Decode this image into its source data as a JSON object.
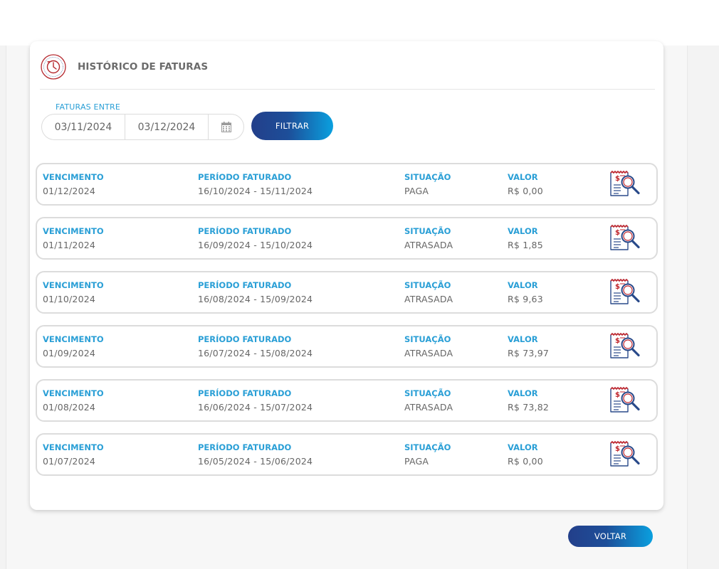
{
  "page": {
    "title": "HISTÓRICO DE FATURAS",
    "icon": "clock-seal-icon",
    "accent_color": "#2a9fd6",
    "brand_color": "#233f8a"
  },
  "filter": {
    "label": "FATURAS ENTRE",
    "start_date": "03/11/2024",
    "end_date": "03/12/2024",
    "button_label": "FILTRAR",
    "calendar_icon": "calendar-icon"
  },
  "columns": {
    "due": "VENCIMENTO",
    "period": "PERÍODO FATURADO",
    "status": "SITUAÇÃO",
    "value": "VALOR"
  },
  "invoices": [
    {
      "due": "01/12/2024",
      "period": "16/10/2024 - 15/11/2024",
      "status": "PAGA",
      "value": "R$ 0,00"
    },
    {
      "due": "01/11/2024",
      "period": "16/09/2024 - 15/10/2024",
      "status": "ATRASADA",
      "value": "R$ 1,85"
    },
    {
      "due": "01/10/2024",
      "period": "16/08/2024 - 15/09/2024",
      "status": "ATRASADA",
      "value": "R$ 9,63"
    },
    {
      "due": "01/09/2024",
      "period": "16/07/2024 - 15/08/2024",
      "status": "ATRASADA",
      "value": "R$ 73,97"
    },
    {
      "due": "01/08/2024",
      "period": "16/06/2024 - 15/07/2024",
      "status": "ATRASADA",
      "value": "R$ 73,82"
    },
    {
      "due": "01/07/2024",
      "period": "16/05/2024 - 15/06/2024",
      "status": "PAGA",
      "value": "R$ 0,00"
    }
  ],
  "row_icon": "invoice-search-icon",
  "back_button": "VOLTAR"
}
